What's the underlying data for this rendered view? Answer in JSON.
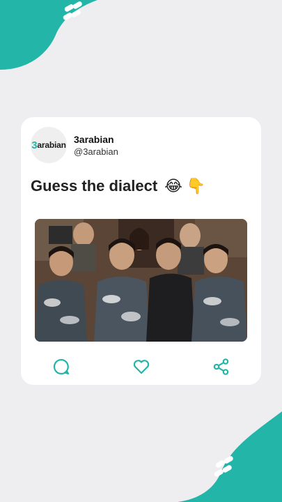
{
  "theme": {
    "accent": "#23b5a8",
    "background": "#eeeef0",
    "card": "#ffffff"
  },
  "post": {
    "avatar_logo": {
      "digit": "3",
      "text": "arabian"
    },
    "display_name": "3arabian",
    "handle": "@3arabian",
    "text": "Guess the dialect",
    "emojis": [
      "😂",
      "👇"
    ],
    "image": {
      "description_icon": "group-photo-image"
    },
    "actions": [
      {
        "name": "comment",
        "icon": "comment-icon"
      },
      {
        "name": "like",
        "icon": "heart-icon"
      },
      {
        "name": "share",
        "icon": "share-icon"
      }
    ]
  }
}
